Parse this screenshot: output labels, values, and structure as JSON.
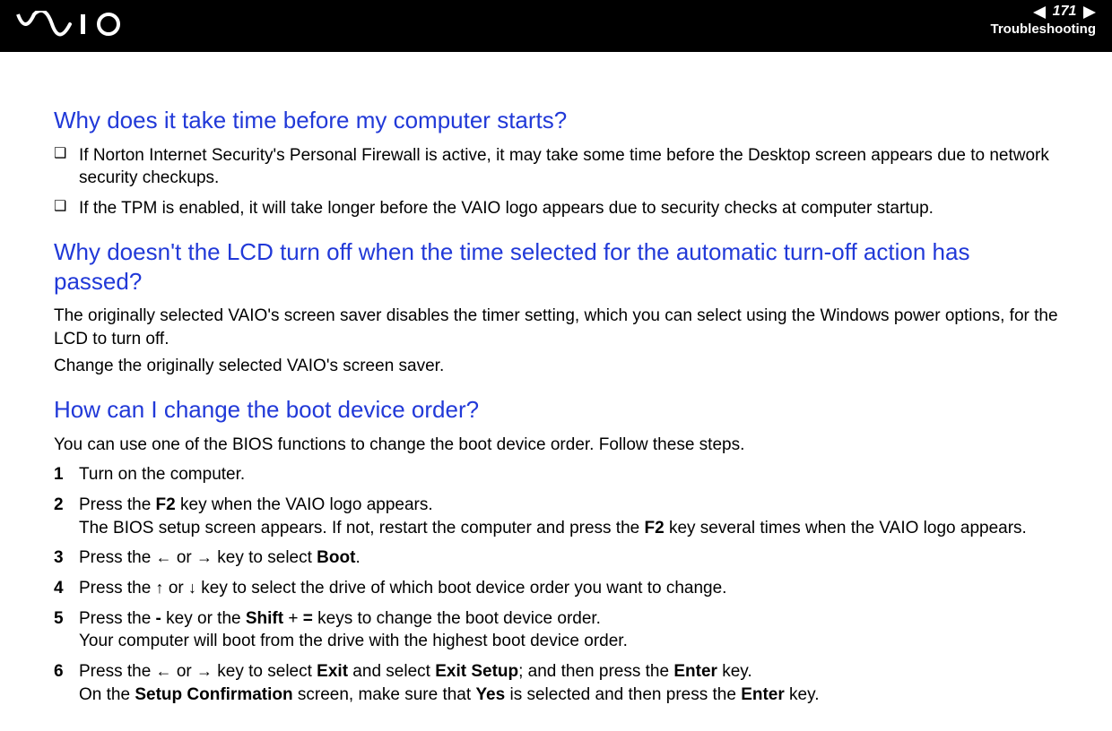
{
  "header": {
    "page_number": "171",
    "section": "Troubleshooting"
  },
  "q1": {
    "title": "Why does it take time before my computer starts?",
    "bullets": [
      "If Norton Internet Security's Personal Firewall is active, it may take some time before the Desktop screen appears due to network security checkups.",
      "If the TPM is enabled, it will take longer before the VAIO logo appears due to security checks at computer startup."
    ]
  },
  "q2": {
    "title": "Why doesn't the LCD turn off when the time selected for the automatic turn-off action has passed?",
    "para1": "The originally selected VAIO's screen saver disables the timer setting, which you can select using the Windows power options, for the LCD to turn off.",
    "para2": "Change the originally selected VAIO's screen saver."
  },
  "q3": {
    "title": "How can I change the boot device order?",
    "intro": "You can use one of the BIOS functions to change the boot device order. Follow these steps.",
    "steps": {
      "s1": "Turn on the computer.",
      "s2a": "Press the ",
      "s2b": " key when the VAIO logo appears.",
      "s2c": "The BIOS setup screen appears. If not, restart the computer and press the ",
      "s2d": " key several times when the VAIO logo appears.",
      "s3a": "Press the ",
      "s3b": " or ",
      "s3c": " key to select ",
      "s3d": ".",
      "s4a": "Press the ",
      "s4b": " or ",
      "s4c": " key to select the drive of which boot device order you want to change.",
      "s5a": "Press the ",
      "s5b": " key or the ",
      "s5c": " + ",
      "s5d": " keys to change the boot device order.",
      "s5e": "Your computer will boot from the drive with the highest boot device order.",
      "s6a": "Press the ",
      "s6b": " or ",
      "s6c": " key to select ",
      "s6d": " and select ",
      "s6e": "; and then press the ",
      "s6f": " key.",
      "s6g": "On the ",
      "s6h": " screen, make sure that ",
      "s6i": " is selected and then press the ",
      "s6j": " key."
    },
    "bold": {
      "f2": "F2",
      "boot": "Boot",
      "minus": "-",
      "shift": "Shift",
      "equals": "=",
      "exit": "Exit",
      "exit_setup": "Exit Setup",
      "enter": "Enter",
      "setup_conf": "Setup Confirmation",
      "yes": "Yes"
    }
  }
}
